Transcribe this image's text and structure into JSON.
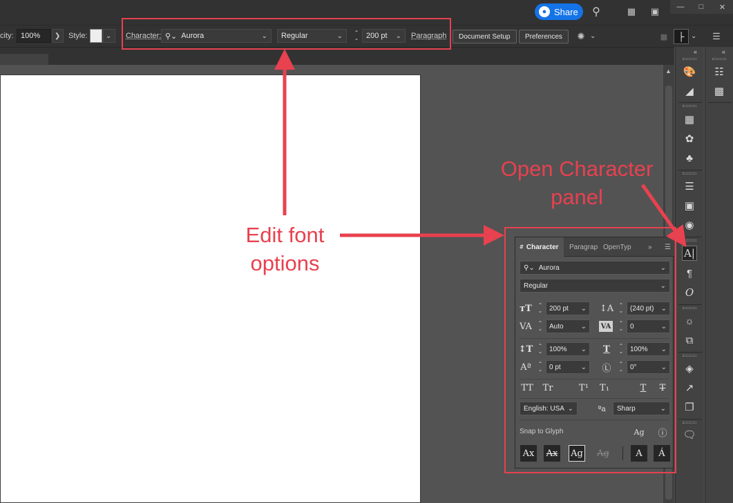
{
  "titlebar": {
    "share_label": "Share",
    "icons": [
      "search-icon",
      "arrange-documents-icon",
      "workspace-icon",
      "minimize-icon",
      "restore-icon",
      "close-icon"
    ],
    "window_controls": [
      "—",
      "□",
      "✕"
    ]
  },
  "controlbar": {
    "opacity_label": "city:",
    "opacity_value": "100%",
    "style_label": "Style:",
    "character_label": "Character:",
    "font_family": "Aurora",
    "font_style": "Regular",
    "font_size": "200 pt",
    "paragraph_label": "Paragraph",
    "document_setup_label": "Document Setup",
    "preferences_label": "Preferences"
  },
  "character_panel": {
    "tabs": [
      "Character",
      "Paragrap",
      "OpenTyp"
    ],
    "font_family": "Aurora",
    "font_style": "Regular",
    "font_size": "200 pt",
    "leading": "(240 pt)",
    "kerning": "Auto",
    "tracking": "0",
    "vertical_scale": "100%",
    "horizontal_scale": "100%",
    "baseline_shift": "0 pt",
    "rotation": "0°",
    "text_style_buttons": [
      "TT",
      "Tr",
      "T¹",
      "T₁",
      "T",
      "T"
    ],
    "language": "English: USA",
    "anti_alias_icon_label": "ªa",
    "anti_alias": "Sharp",
    "snap_to_glyph_label": "Snap to Glyph",
    "snap_buttons": [
      "Ax",
      "Ax",
      "Ag",
      "Ag",
      "A",
      "Á"
    ]
  },
  "annotations": {
    "edit_font_line1": "Edit font",
    "edit_font_line2": "options",
    "open_char_line1": "Open Character",
    "open_char_line2": "panel"
  },
  "colors": {
    "annotation": "#e8414f",
    "share_button": "#1473e6",
    "ui_dark": "#323232",
    "ui_mid": "#535353"
  }
}
